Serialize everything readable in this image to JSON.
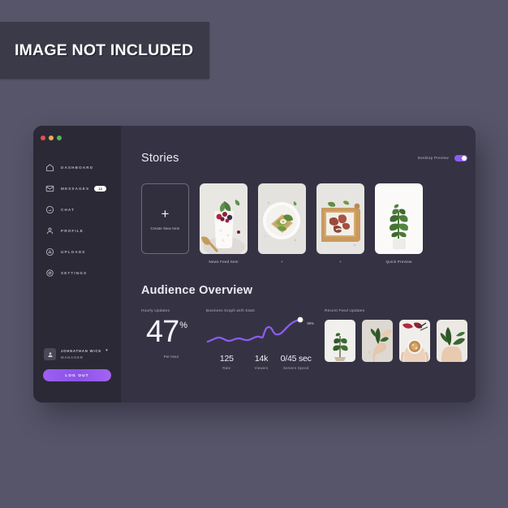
{
  "watermark": {
    "text": "IMAGE NOT INCLUDED"
  },
  "window": {
    "traffic_lights": [
      "close",
      "minimize",
      "maximize"
    ]
  },
  "sidebar": {
    "items": [
      {
        "label": "DASHBOARD",
        "icon": "home-icon",
        "badge": null
      },
      {
        "label": "MESSAGES",
        "icon": "envelope-icon",
        "badge": "12"
      },
      {
        "label": "CHAT",
        "icon": "chat-bubble-icon",
        "badge": null
      },
      {
        "label": "PROFILE",
        "icon": "user-icon",
        "badge": null
      },
      {
        "label": "UPLOADS",
        "icon": "cloud-upload-icon",
        "badge": null
      },
      {
        "label": "SETTINGS",
        "icon": "gear-icon",
        "badge": null
      }
    ],
    "user": {
      "name": "JOHNATHAN WICK",
      "role": "MANAGER",
      "caret": "▾"
    },
    "logout_label": "LOG OUT"
  },
  "stories": {
    "title": "Stories",
    "toggle": {
      "label": "Desktop Preview",
      "on": true
    },
    "cards": [
      {
        "type": "create",
        "plus": "+",
        "inner_label": "Create New Item",
        "caption": ""
      },
      {
        "type": "photo",
        "subject": "yogurt-parfait-berries",
        "caption": "News Feed Item"
      },
      {
        "type": "photo",
        "subject": "avocado-toast-greens",
        "caption": "+"
      },
      {
        "type": "photo",
        "subject": "meat-on-board",
        "caption": "+"
      },
      {
        "type": "photo",
        "subject": "green-plant",
        "caption": "Quick Preview"
      }
    ]
  },
  "audience": {
    "title": "Audience Overview",
    "hourly": {
      "label": "Hourly Updates",
      "value": "47",
      "unit": "%",
      "sublabel": "Per Hour"
    },
    "graph": {
      "label": "Business Graph with Stats",
      "endpoint_label": "90%",
      "stats": [
        {
          "value": "125",
          "key": "Rate"
        },
        {
          "value": "14k",
          "key": "Viewers"
        },
        {
          "value": "0/45 sec",
          "key": "Servers Speed"
        }
      ]
    },
    "feed": {
      "label": "Recent Feed Updates",
      "cards": [
        {
          "subject": "potted-fiddle-leaf-plant"
        },
        {
          "subject": "hand-holding-branch"
        },
        {
          "subject": "hands-with-bowl"
        },
        {
          "subject": "hand-with-leaves"
        }
      ]
    }
  },
  "chart_data": {
    "type": "line",
    "title": "Business Graph with Stats",
    "x": [
      0,
      1,
      2,
      3,
      4,
      5,
      6,
      7,
      8,
      9,
      10,
      11,
      12
    ],
    "values": [
      30,
      34,
      30,
      27,
      32,
      30,
      33,
      36,
      58,
      52,
      48,
      66,
      90
    ],
    "ylim": [
      0,
      100
    ],
    "annotations": [
      "90%"
    ],
    "line_color": "#8b5cf0",
    "grid": false,
    "legend": false
  },
  "colors": {
    "page_bg": "#575569",
    "window_bg": "#312f3d",
    "sidebar_bg": "#2b2936",
    "main_bg": "#353343",
    "accent": "#8b5cf0",
    "text_primary": "#eceaf3",
    "text_muted": "#b4b1c2"
  }
}
